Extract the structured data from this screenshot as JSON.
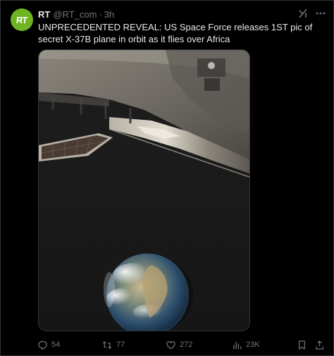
{
  "post": {
    "author_name": "RT",
    "author_handle": "@RT_com",
    "separator": "·",
    "timestamp": "3h",
    "avatar_text": "RT",
    "text": "UNPRECEDENTED REVEAL: US Space Force releases 1ST pic of secret X-37B plane in orbit as it flies over Africa"
  },
  "media": {
    "subject": "X-37B spaceplane in orbit above Earth"
  },
  "actions": {
    "replies": "54",
    "reposts": "77",
    "likes": "272",
    "views": "23K"
  },
  "icons": {
    "grok": "grok-icon",
    "more": "more-options-icon",
    "reply": "reply-icon",
    "repost": "repost-icon",
    "like": "like-icon",
    "views": "views-icon",
    "bookmark": "bookmark-icon",
    "share": "share-icon"
  },
  "colors": {
    "background": "#000000",
    "text": "#e7e9ea",
    "muted": "#71767b",
    "avatar": "#6fb423",
    "border": "#2f3336"
  }
}
